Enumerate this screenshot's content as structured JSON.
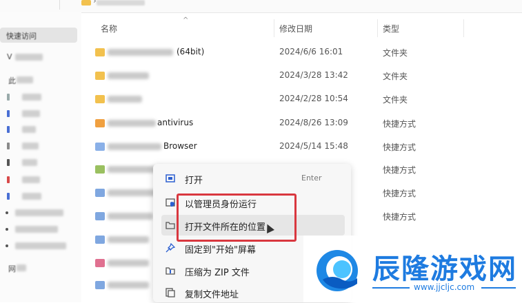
{
  "sidebar": {
    "quick_access": "快速访问",
    "item_v": "V",
    "item_this_pc": "此",
    "item_net": "网"
  },
  "columns": {
    "name": "名称",
    "date": "修改日期",
    "type": "类型"
  },
  "files": [
    {
      "kind": "folder",
      "name_suffix": "(64bit)",
      "date": "2024/6/6 16:01",
      "type": "文件夹"
    },
    {
      "kind": "folder",
      "name_suffix": "",
      "date": "2024/3/28 13:42",
      "type": "文件夹"
    },
    {
      "kind": "folder",
      "name_suffix": "",
      "date": "2024/2/28 10:54",
      "type": "文件夹"
    },
    {
      "kind": "shortcut",
      "name_suffix": "antivirus",
      "date": "2024/8/26 13:09",
      "type": "快捷方式"
    },
    {
      "kind": "shortcut",
      "name_suffix": "Browser",
      "date": "2024/5/14 15:48",
      "type": "快捷方式"
    },
    {
      "kind": "shortcut",
      "name_suffix": "",
      "date": "",
      "type": "快捷方式"
    },
    {
      "kind": "shortcut",
      "name_suffix": "",
      "date": "",
      "type": "快捷方式"
    },
    {
      "kind": "shortcut",
      "name_suffix": "",
      "date": "",
      "type": "快捷方式"
    }
  ],
  "context_menu": {
    "open": "打开",
    "open_shortcut": "Enter",
    "run_as_admin": "以管理员身份运行",
    "open_location": "打开文件所在的位置",
    "pin_start": "固定到\"开始\"屏幕",
    "compress_zip": "压缩为 ZIP 文件",
    "copy_path": "复制文件地址"
  },
  "watermark": {
    "title": "辰隆游戏网",
    "url": "www.jjcljc.com"
  },
  "colors": {
    "folder": "#f2c14e",
    "highlight_box": "#d9373f",
    "watermark": "#1e7be0"
  }
}
